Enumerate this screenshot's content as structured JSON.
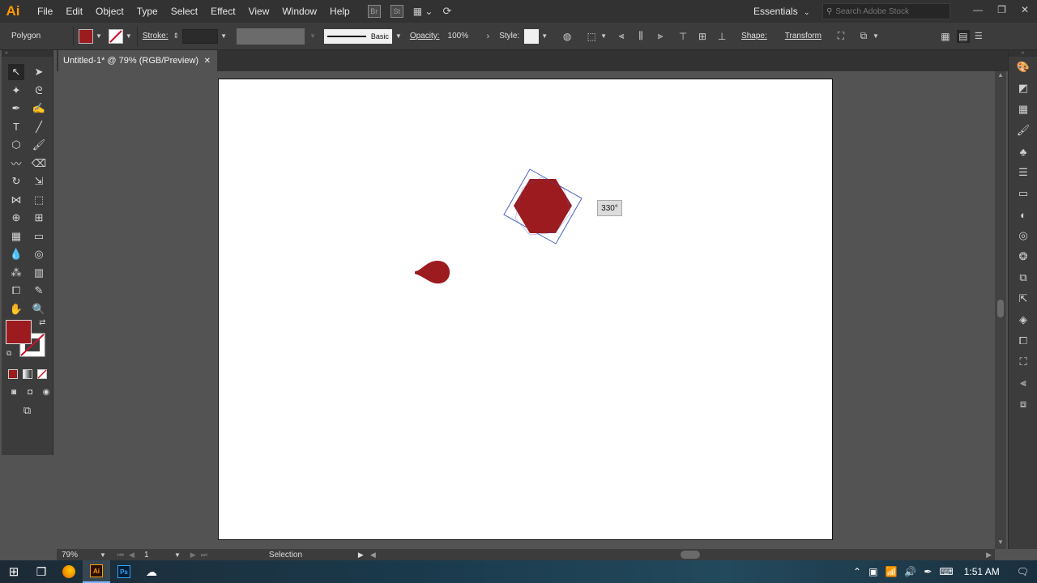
{
  "app": {
    "logo_text": "Ai"
  },
  "menu": {
    "items": [
      "File",
      "Edit",
      "Object",
      "Type",
      "Select",
      "Effect",
      "View",
      "Window",
      "Help"
    ],
    "bridge_label": "Br",
    "stock_label": "St"
  },
  "workspace": {
    "label": "Essentials"
  },
  "search": {
    "placeholder": "Search Adobe Stock"
  },
  "window_controls": {
    "minimize": "—",
    "restore": "❐",
    "close": "✕"
  },
  "controlbar": {
    "object_type": "Polygon",
    "fill_color": "#9b1b1f",
    "stroke_label": "Stroke:",
    "brush_label": "Basic",
    "opacity_label": "Opacity:",
    "opacity_value": "100%",
    "style_label": "Style:",
    "shape_label": "Shape:",
    "transform_label": "Transform"
  },
  "document": {
    "tab_title": "Untitled-1* @ 79% (RGB/Preview)"
  },
  "canvas": {
    "rotation_tooltip": "330°",
    "shape_color": "#9b1b1f",
    "bbox_color": "#4a5fc1"
  },
  "statusbar": {
    "zoom": "79%",
    "page": "1",
    "tool": "Selection"
  },
  "taskbar": {
    "ai_label": "Ai",
    "ps_label": "Ps",
    "time": "1:51 AM"
  }
}
